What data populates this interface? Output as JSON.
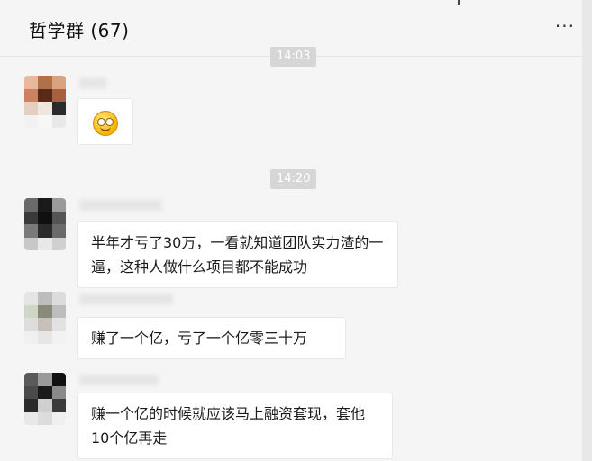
{
  "header": {
    "title": "哲学群 (67)",
    "more": "···"
  },
  "timestamps": [
    "14:03",
    "14:20"
  ],
  "messages": [
    {
      "text": "",
      "emoji": "grinning-face-icon"
    },
    {
      "text": "半年才亏了30万，一看就知道团队实力渣的一逼，这种人做什么项目都不能成功"
    },
    {
      "text": "赚了一个亿，亏了一个亿零三十万"
    },
    {
      "text": "赚一个亿的时候就应该马上融资套现，套他10个亿再走"
    }
  ],
  "colors": {
    "background": "#f5f5f5",
    "bubble": "#ffffff",
    "timestamp_bg": "#d6d6d6"
  }
}
